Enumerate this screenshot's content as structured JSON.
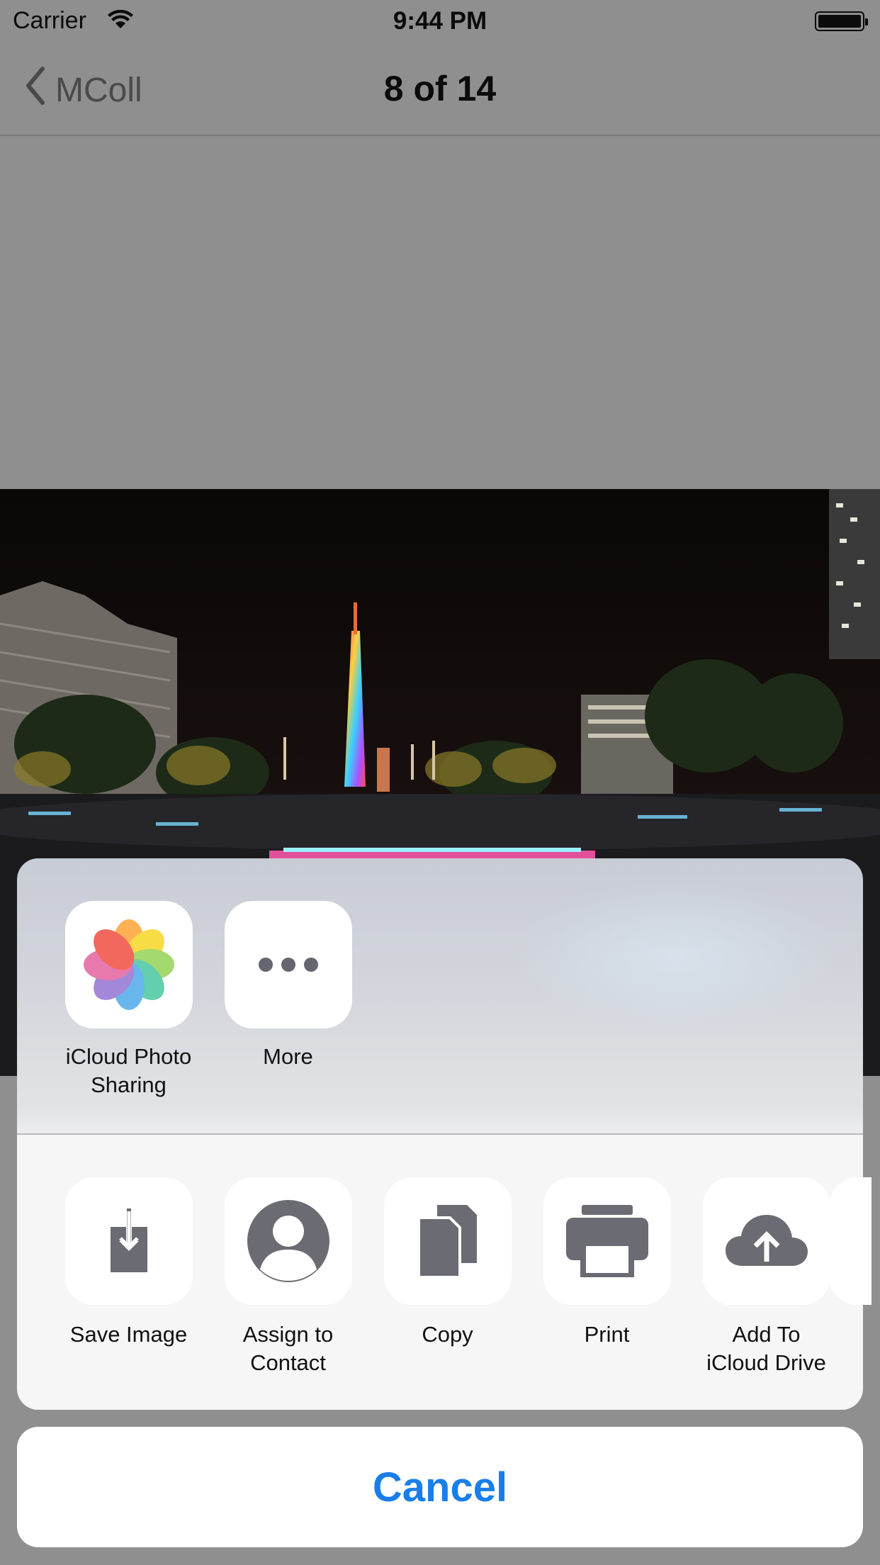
{
  "status_bar": {
    "carrier": "Carrier",
    "time": "9:44 PM",
    "wifi_icon": "wifi-icon",
    "battery_icon": "battery-icon"
  },
  "nav": {
    "back_label": "MColl",
    "title": "8 of 14",
    "back_icon": "chevron-left-icon"
  },
  "photo": {
    "description_icon": "night-cityscape-photo"
  },
  "share_sheet": {
    "apps": [
      {
        "label": "iCloud Photo\nSharing",
        "icon": "photos-app-icon"
      },
      {
        "label": "More",
        "icon": "more-dots-icon"
      }
    ],
    "actions": [
      {
        "label": "Save Image",
        "icon": "save-image-icon"
      },
      {
        "label": "Assign to\nContact",
        "icon": "contact-icon"
      },
      {
        "label": "Copy",
        "icon": "copy-icon"
      },
      {
        "label": "Print",
        "icon": "print-icon"
      },
      {
        "label": "Add To\niCloud Drive",
        "icon": "icloud-upload-icon"
      }
    ]
  },
  "cancel": {
    "label": "Cancel"
  },
  "colors": {
    "accent": "#1a7ee8",
    "dimmed_background": "#8f8f8f",
    "icon_gray": "#6b6b73"
  }
}
